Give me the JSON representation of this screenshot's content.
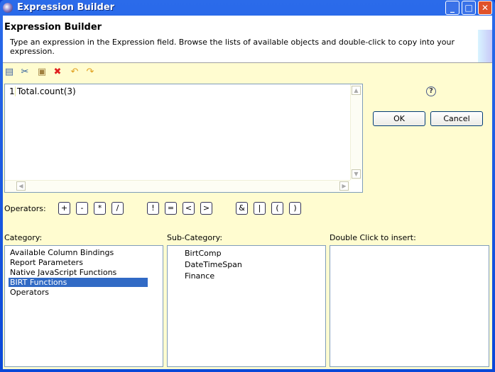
{
  "window": {
    "title": "Expression Builder"
  },
  "header": {
    "title": "Expression Builder",
    "description": "Type an expression in the Expression field. Browse the lists of available objects and double-click to copy into your expression."
  },
  "toolbar": [
    "copy-icon",
    "cut-icon",
    "paste-icon",
    "delete-icon",
    "undo-icon",
    "redo-icon"
  ],
  "editor": {
    "line_number": "1",
    "text": "Total.count(3)"
  },
  "buttons": {
    "ok": "OK",
    "cancel": "Cancel",
    "help": "?"
  },
  "operators": {
    "label": "Operators:",
    "items": [
      "+",
      "-",
      "*",
      "/",
      "!",
      "=",
      "<",
      ">",
      "&",
      "|",
      "(",
      ")"
    ]
  },
  "category": {
    "label": "Category:",
    "items": [
      "Available Column Bindings",
      "Report Parameters",
      "Native JavaScript Functions",
      "BIRT Functions",
      "Operators"
    ],
    "selected": "BIRT Functions"
  },
  "subcategory": {
    "label": "Sub-Category:",
    "items": [
      "BirtComp",
      "DateTimeSpan",
      "Finance"
    ]
  },
  "insert": {
    "label": "Double Click to insert:",
    "items": []
  }
}
